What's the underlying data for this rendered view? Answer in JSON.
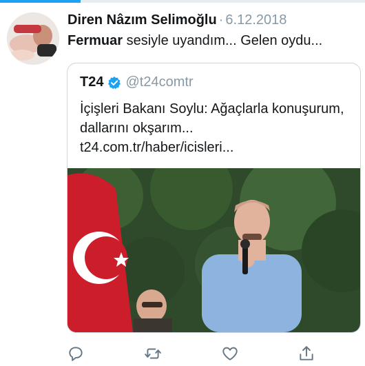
{
  "progress": {
    "fraction": 0.22,
    "color": "#1da1f2"
  },
  "tweet": {
    "author": "Diren Nâzım Selimoğlu",
    "separator": "·",
    "date": "6.12.2018",
    "text_bold": "Fermuar",
    "text_rest": " sesiyle uyandım... Gelen oydu..."
  },
  "card": {
    "source_name": "T24",
    "handle": "@t24comtr",
    "title": "İçişleri Bakanı Soylu: Ağaçlarla konuşurum, dallarını okşarım...",
    "link": "t24.com.tr/haber/icisleri..."
  },
  "actions": {
    "icons": [
      "reply-icon",
      "retweet-icon",
      "like-icon",
      "share-icon"
    ]
  },
  "colors": {
    "muted": "#8899a6",
    "verified": "#1da1f2",
    "border": "#ccd6dd"
  }
}
